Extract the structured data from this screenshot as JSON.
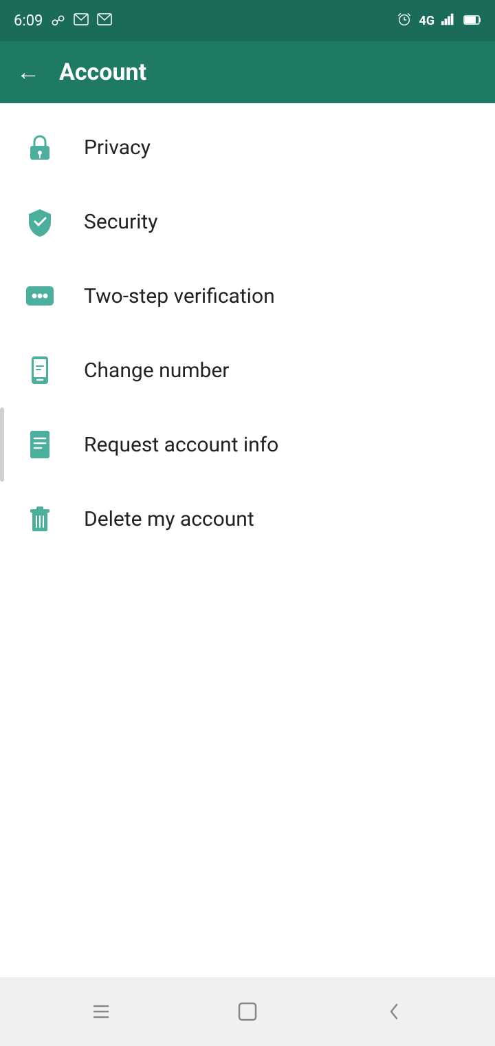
{
  "status_bar": {
    "time": "6:09",
    "icons_left": [
      "image-icon",
      "gmail-icon",
      "gmail2-icon"
    ],
    "icons_right": [
      "alarm-icon",
      "4g-icon",
      "signal-icon",
      "battery-icon"
    ]
  },
  "toolbar": {
    "back_label": "←",
    "title": "Account"
  },
  "menu": {
    "items": [
      {
        "id": "privacy",
        "label": "Privacy",
        "icon": "lock-icon"
      },
      {
        "id": "security",
        "label": "Security",
        "icon": "shield-icon"
      },
      {
        "id": "two-step",
        "label": "Two-step verification",
        "icon": "dots-icon"
      },
      {
        "id": "change-number",
        "label": "Change number",
        "icon": "phone-edit-icon"
      },
      {
        "id": "request-account-info",
        "label": "Request account info",
        "icon": "document-icon"
      },
      {
        "id": "delete-account",
        "label": "Delete my account",
        "icon": "trash-icon"
      }
    ]
  },
  "nav_bar": {
    "recent_label": "|||",
    "home_label": "○",
    "back_label": "<"
  },
  "colors": {
    "teal": "#4CAF9E",
    "dark_teal": "#1e7a63",
    "status_teal": "#1a6b5a"
  }
}
